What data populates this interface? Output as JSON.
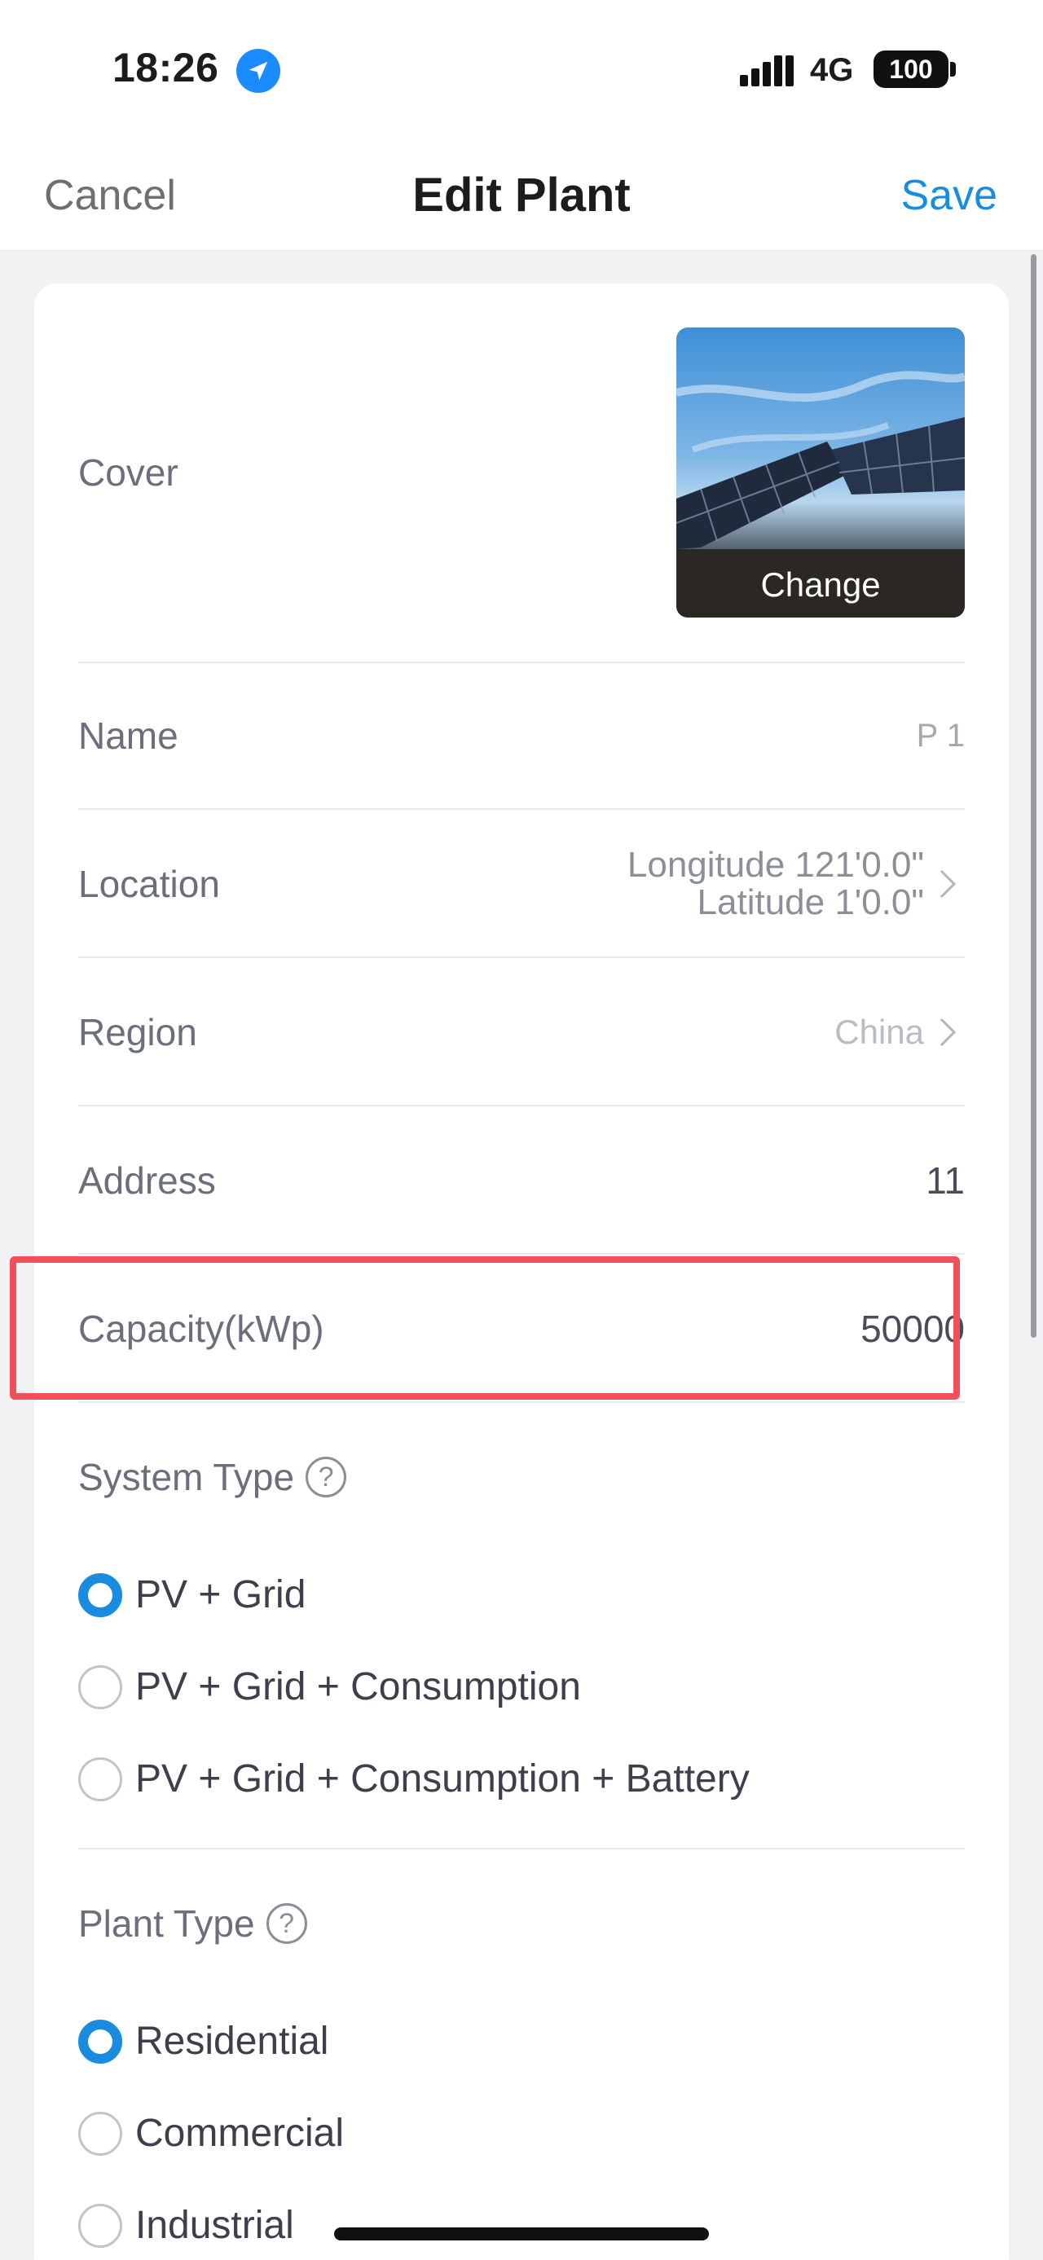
{
  "status_bar": {
    "time": "18:26",
    "network": "4G",
    "battery": "100"
  },
  "nav": {
    "cancel_label": "Cancel",
    "title": "Edit Plant",
    "save_label": "Save"
  },
  "form": {
    "cover": {
      "label": "Cover",
      "change_label": "Change"
    },
    "name": {
      "label": "Name",
      "value": "P 1"
    },
    "location": {
      "label": "Location",
      "line1": "Longitude 121'0.0\"",
      "line2": "Latitude 1'0.0\""
    },
    "region": {
      "label": "Region",
      "value": "China"
    },
    "address": {
      "label": "Address",
      "value": "11"
    },
    "capacity": {
      "label": "Capacity(kWp)",
      "value": "50000"
    },
    "system_type": {
      "label": "System Type",
      "help": "?",
      "options": [
        {
          "label": "PV + Grid",
          "selected": true
        },
        {
          "label": "PV + Grid + Consumption",
          "selected": false
        },
        {
          "label": "PV + Grid + Consumption + Battery",
          "selected": false
        }
      ]
    },
    "plant_type": {
      "label": "Plant Type",
      "help": "?",
      "options": [
        {
          "label": "Residential",
          "selected": true
        },
        {
          "label": "Commercial",
          "selected": false
        },
        {
          "label": "Industrial",
          "selected": false
        }
      ]
    }
  },
  "colors": {
    "accent": "#1a8ce0",
    "highlight": "#f0505a",
    "background": "#f2f2f4"
  }
}
